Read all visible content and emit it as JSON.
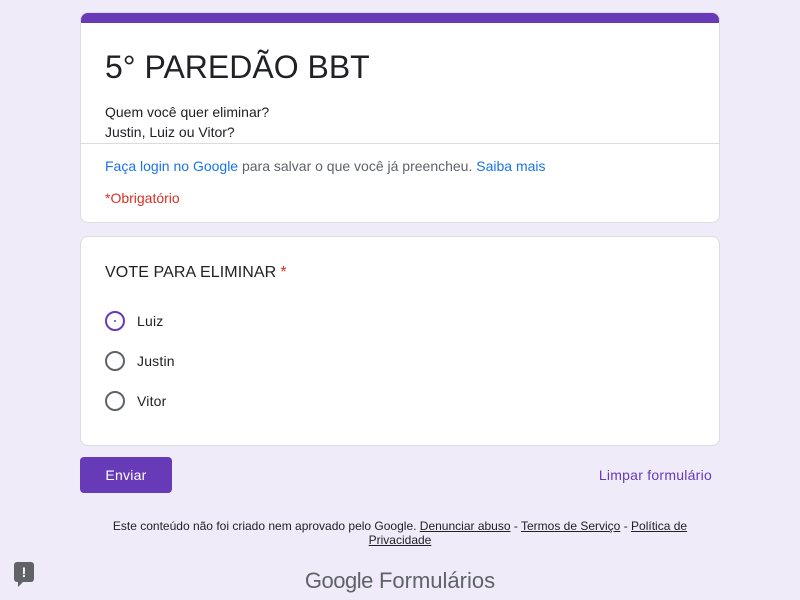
{
  "form": {
    "title": "5° PAREDÃO BBT",
    "description_line1": "Quem você quer eliminar?",
    "description_line2": "Justin, Luiz ou Vitor?",
    "login_link": "Faça login no Google",
    "login_text": " para salvar o que você já preencheu. ",
    "learn_more": "Saiba mais",
    "required_note": "*Obrigatório"
  },
  "question": {
    "title": "VOTE PARA ELIMINAR",
    "required_mark": "*",
    "options": [
      "Luiz",
      "Justin",
      "Vitor"
    ]
  },
  "actions": {
    "submit": "Enviar",
    "clear": "Limpar formulário"
  },
  "footer": {
    "disclaimer": "Este conteúdo não foi criado nem aprovado pelo Google.",
    "report_abuse": "Denunciar abuso",
    "sep1": " - ",
    "terms": "Termos de Serviço",
    "sep2": " - ",
    "privacy": "Política de Privacidade",
    "brand_google": "Google",
    "brand_forms": "Formulários"
  },
  "colors": {
    "accent": "#673ab7",
    "background": "#f0ebf8",
    "link": "#1a73e8",
    "required": "#d93025"
  },
  "icons": {
    "feedback": "report-feedback-icon"
  }
}
